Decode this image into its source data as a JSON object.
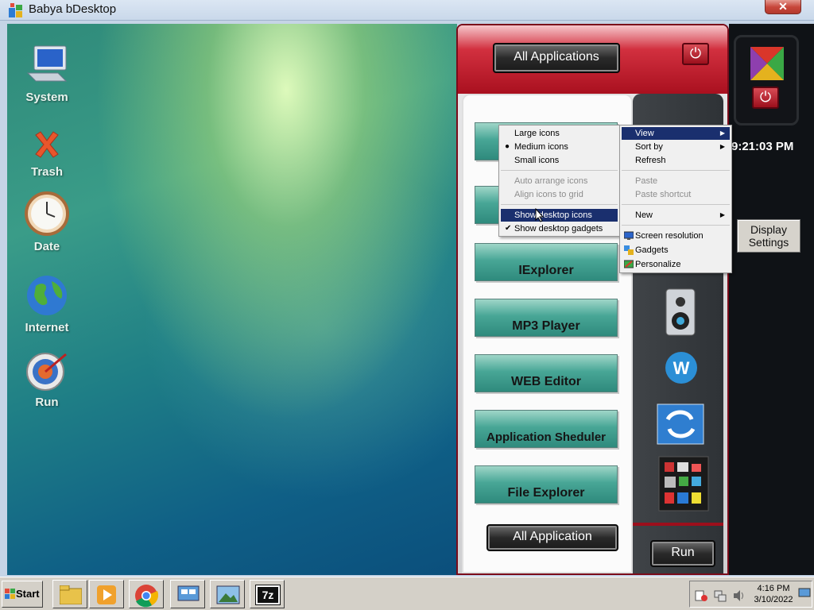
{
  "window": {
    "title": "Babya bDesktop",
    "close_label": "✕"
  },
  "desktop_icons": [
    {
      "label": "System",
      "icon": "computer-icon"
    },
    {
      "label": "Trash",
      "icon": "trash-icon"
    },
    {
      "label": "Date",
      "icon": "clock-icon"
    },
    {
      "label": "Internet",
      "icon": "globe-icon"
    },
    {
      "label": "Run",
      "icon": "run-target-icon"
    }
  ],
  "panel": {
    "all_applications_label": "All Applications",
    "all_application_label": "All Application",
    "run_label": "Run",
    "apps": [
      "IExplorer",
      "MP3 Player",
      "WEB Editor",
      "Application Sheduler",
      "File Explorer"
    ],
    "clock": "9:21:03 PM",
    "display_settings_label": "Display Settings"
  },
  "context_menu_left": {
    "items": [
      {
        "label": "Large icons",
        "state": ""
      },
      {
        "label": "Medium icons",
        "state": "bullet"
      },
      {
        "label": "Small icons",
        "state": ""
      },
      {
        "label": "Auto arrange icons",
        "state": "disabled"
      },
      {
        "label": "Align icons to grid",
        "state": "disabled"
      },
      {
        "label": "Show desktop icons",
        "state": "highlighted"
      },
      {
        "label": "Show desktop gadgets",
        "state": "check"
      }
    ]
  },
  "context_menu_right": {
    "items": [
      {
        "label": "View",
        "state": "highlighted",
        "submenu": true
      },
      {
        "label": "Sort by",
        "state": "",
        "submenu": true
      },
      {
        "label": "Refresh",
        "state": ""
      },
      {
        "label": "Paste",
        "state": "disabled"
      },
      {
        "label": "Paste shortcut",
        "state": "disabled"
      },
      {
        "label": "New",
        "state": "",
        "submenu": true
      },
      {
        "label": "Screen resolution",
        "state": "",
        "icon": "monitor-icon"
      },
      {
        "label": "Gadgets",
        "state": "",
        "icon": "gadgets-icon"
      },
      {
        "label": "Personalize",
        "state": "",
        "icon": "personalize-icon"
      }
    ]
  },
  "taskbar": {
    "start_label": "Start",
    "time": "4:16 PM",
    "date": "3/10/2022",
    "apps": [
      "file-explorer-icon",
      "media-player-icon",
      "chrome-icon",
      "network-icon",
      "image-viewer-icon",
      "7zip-icon"
    ],
    "zip_label": "7z"
  },
  "colors": {
    "menu_highlight": "#1a2f6e",
    "panel_red": "#a9101f",
    "app_button": "#48a696"
  }
}
